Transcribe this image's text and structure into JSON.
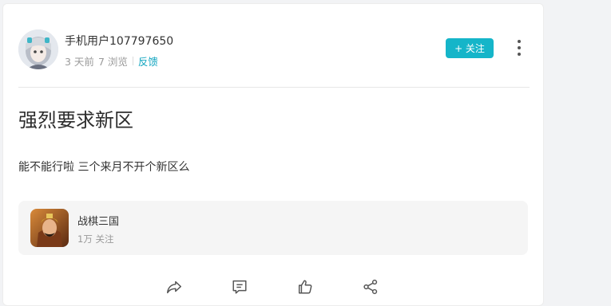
{
  "post": {
    "author": {
      "username": "手机用户107797650",
      "time_ago": "3 天前",
      "views": "7 浏览",
      "feedback_label": "反馈"
    },
    "follow_label": "+ 关注",
    "title": "强烈要求新区",
    "body": "能不能行啦 三个来月不开个新区么"
  },
  "game": {
    "name": "战棋三国",
    "followers": "1万 关注"
  },
  "actions": {
    "icons": [
      "forward-icon",
      "comment-icon",
      "like-icon",
      "share-icon"
    ]
  },
  "colors": {
    "accent": "#15b5c9",
    "link": "#14a6c0"
  }
}
